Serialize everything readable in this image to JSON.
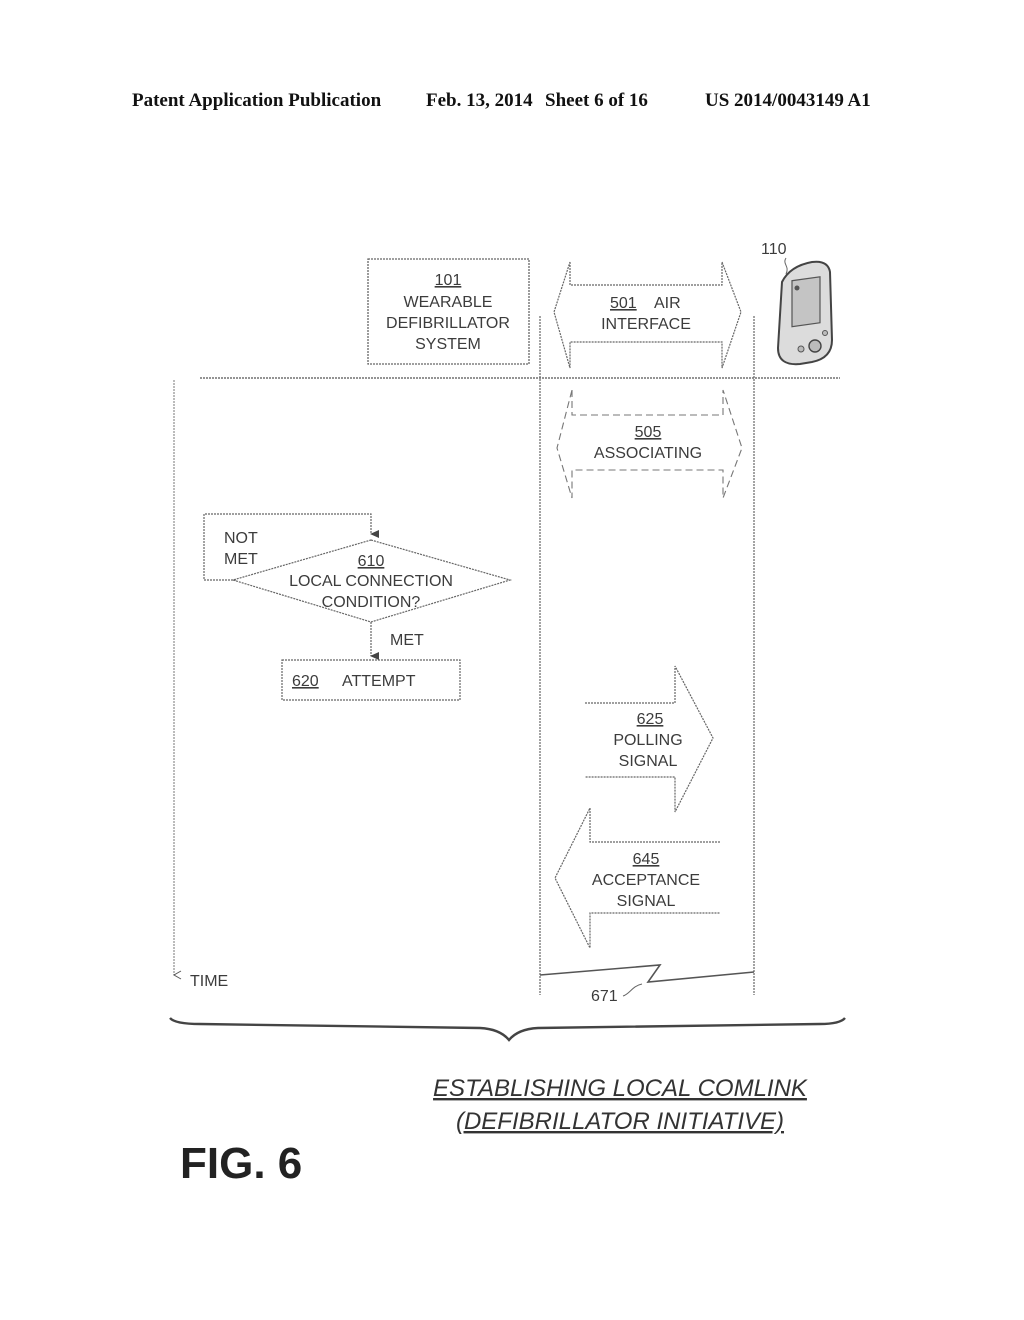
{
  "header": {
    "publication": "Patent Application Publication",
    "date": "Feb. 13, 2014",
    "sheet": "Sheet 6 of 16",
    "number": "US 2014/0043149 A1"
  },
  "figure": {
    "label": "FIG. 6",
    "title_line1": "ESTABLISHING LOCAL COMLINK",
    "title_line2": "(DEFIBRILLATOR INITIATIVE)",
    "system_box": {
      "ref": "101",
      "line1": "WEARABLE",
      "line2": "DEFIBRILLATOR",
      "line3": "SYSTEM"
    },
    "air_interface": {
      "ref": "501",
      "text1": "AIR",
      "text2": "INTERFACE"
    },
    "device": {
      "ref": "110"
    },
    "associating": {
      "ref": "505",
      "text": "ASSOCIATING"
    },
    "decision": {
      "ref": "610",
      "line1": "LOCAL CONNECTION",
      "line2": "CONDITION?",
      "not_met_1": "NOT",
      "not_met_2": "MET",
      "met": "MET"
    },
    "attempt": {
      "ref": "620",
      "text": "ATTEMPT"
    },
    "polling": {
      "ref": "625",
      "line1": "POLLING",
      "line2": "SIGNAL"
    },
    "acceptance": {
      "ref": "645",
      "line1": "ACCEPTANCE",
      "line2": "SIGNAL"
    },
    "link": {
      "ref": "671"
    },
    "time_label": "TIME"
  }
}
